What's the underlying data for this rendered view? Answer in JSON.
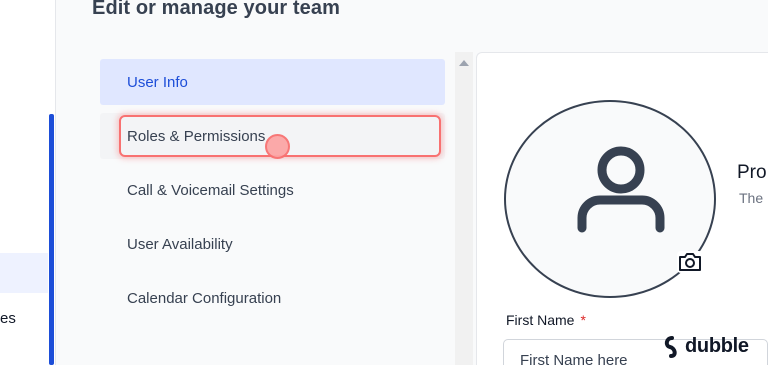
{
  "sidebar": {
    "partial_label": "es"
  },
  "page": {
    "title": "Edit or manage your team"
  },
  "menu": {
    "items": [
      {
        "label": "User Info"
      },
      {
        "label": "Roles & Permissions"
      },
      {
        "label": "Call & Voicemail Settings"
      },
      {
        "label": "User Availability"
      },
      {
        "label": "Calendar Configuration"
      }
    ]
  },
  "profile": {
    "heading": "Pro",
    "subtext": "The"
  },
  "form": {
    "first_name_label": "First Name",
    "required_mark": "*",
    "first_name_placeholder": "First Name here"
  },
  "watermark": {
    "text": "dubble"
  },
  "icons": {
    "avatar": "user-placeholder-icon",
    "camera": "camera-icon",
    "scroll_up": "scroll-up-arrow-icon",
    "watermark_logo": "dubble-logo-icon"
  },
  "colors": {
    "accent": "#1d4ed8",
    "active_bg": "#e0e7ff",
    "highlight": "#f87171"
  }
}
